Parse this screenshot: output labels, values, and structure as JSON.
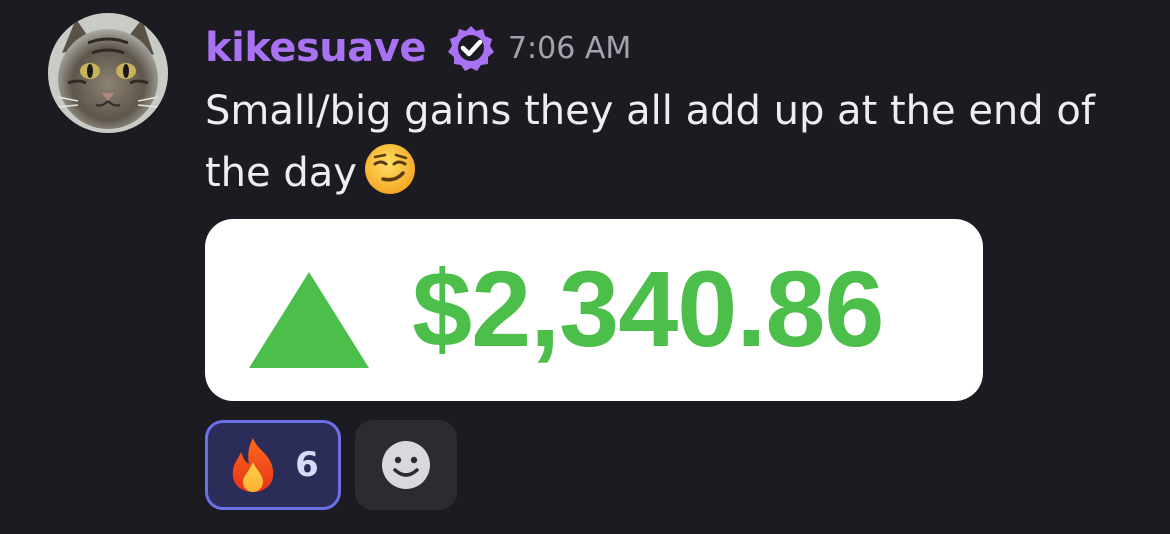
{
  "message": {
    "author": "kikesuave",
    "timestamp": "7:06 AM",
    "text": "Small/big gains they all add up at the end of the day",
    "author_color": "#a872f3"
  },
  "icons": {
    "avatar": "cat-avatar",
    "badge": "verified-badge-icon",
    "text_emoji": "smirking-face-emoji",
    "embed_arrow": "up-triangle-icon",
    "reaction_emoji": "fire-emoji",
    "add_reaction": "add-reaction-smile-icon"
  },
  "embed": {
    "amount": "$2,340.86",
    "color": "#4cbe4a"
  },
  "reactions": [
    {
      "emoji": "fire",
      "count": "6"
    }
  ]
}
